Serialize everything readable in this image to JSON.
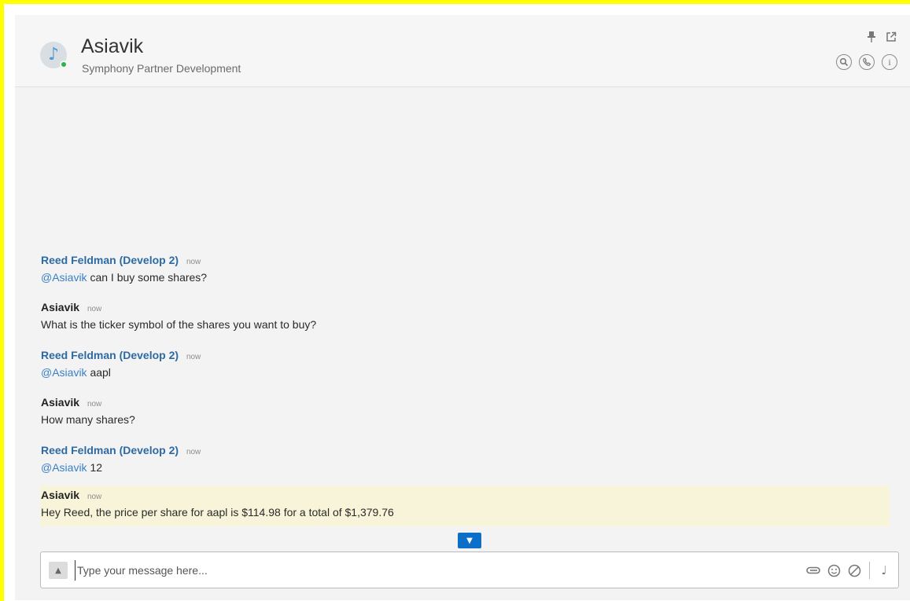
{
  "header": {
    "title": "Asiavik",
    "subtitle": "Symphony Partner Development",
    "icons": [
      "music-note-avatar",
      "pin-icon",
      "popout-icon",
      "search-icon",
      "phone-icon",
      "info-icon"
    ]
  },
  "messages": [
    {
      "author": "Reed Feldman (Develop 2)",
      "time": "now",
      "mention": "@Asiavik",
      "text": " can I buy some shares?"
    },
    {
      "author": "Asiavik",
      "time": "now",
      "mention": "",
      "text": "What is the ticker symbol of the shares you want to buy?"
    },
    {
      "author": "Reed Feldman (Develop 2)",
      "time": "now",
      "mention": "@Asiavik",
      "text": " aapl"
    },
    {
      "author": "Asiavik",
      "time": "now",
      "mention": "",
      "text": "How many shares?"
    },
    {
      "author": "Reed Feldman (Develop 2)",
      "time": "now",
      "mention": "@Asiavik",
      "text": " 12"
    },
    {
      "author": "Asiavik",
      "time": "now",
      "mention": "",
      "text": "Hey Reed, the price per share for aapl is $114.98 for a total of $1,379.76"
    }
  ],
  "composer": {
    "placeholder": "Type your message here...",
    "value": "",
    "tools": [
      "chevron-up-icon",
      "attach-icon",
      "emoji-icon",
      "block-icon",
      "music-icon"
    ]
  },
  "colors": {
    "highlight": "#f8f4d9",
    "accent": "#0d6ec9",
    "user_name": "#2d6aa3",
    "mention": "#3a7fc4",
    "presence": "#2fb14c",
    "frame": "#ffff00"
  }
}
